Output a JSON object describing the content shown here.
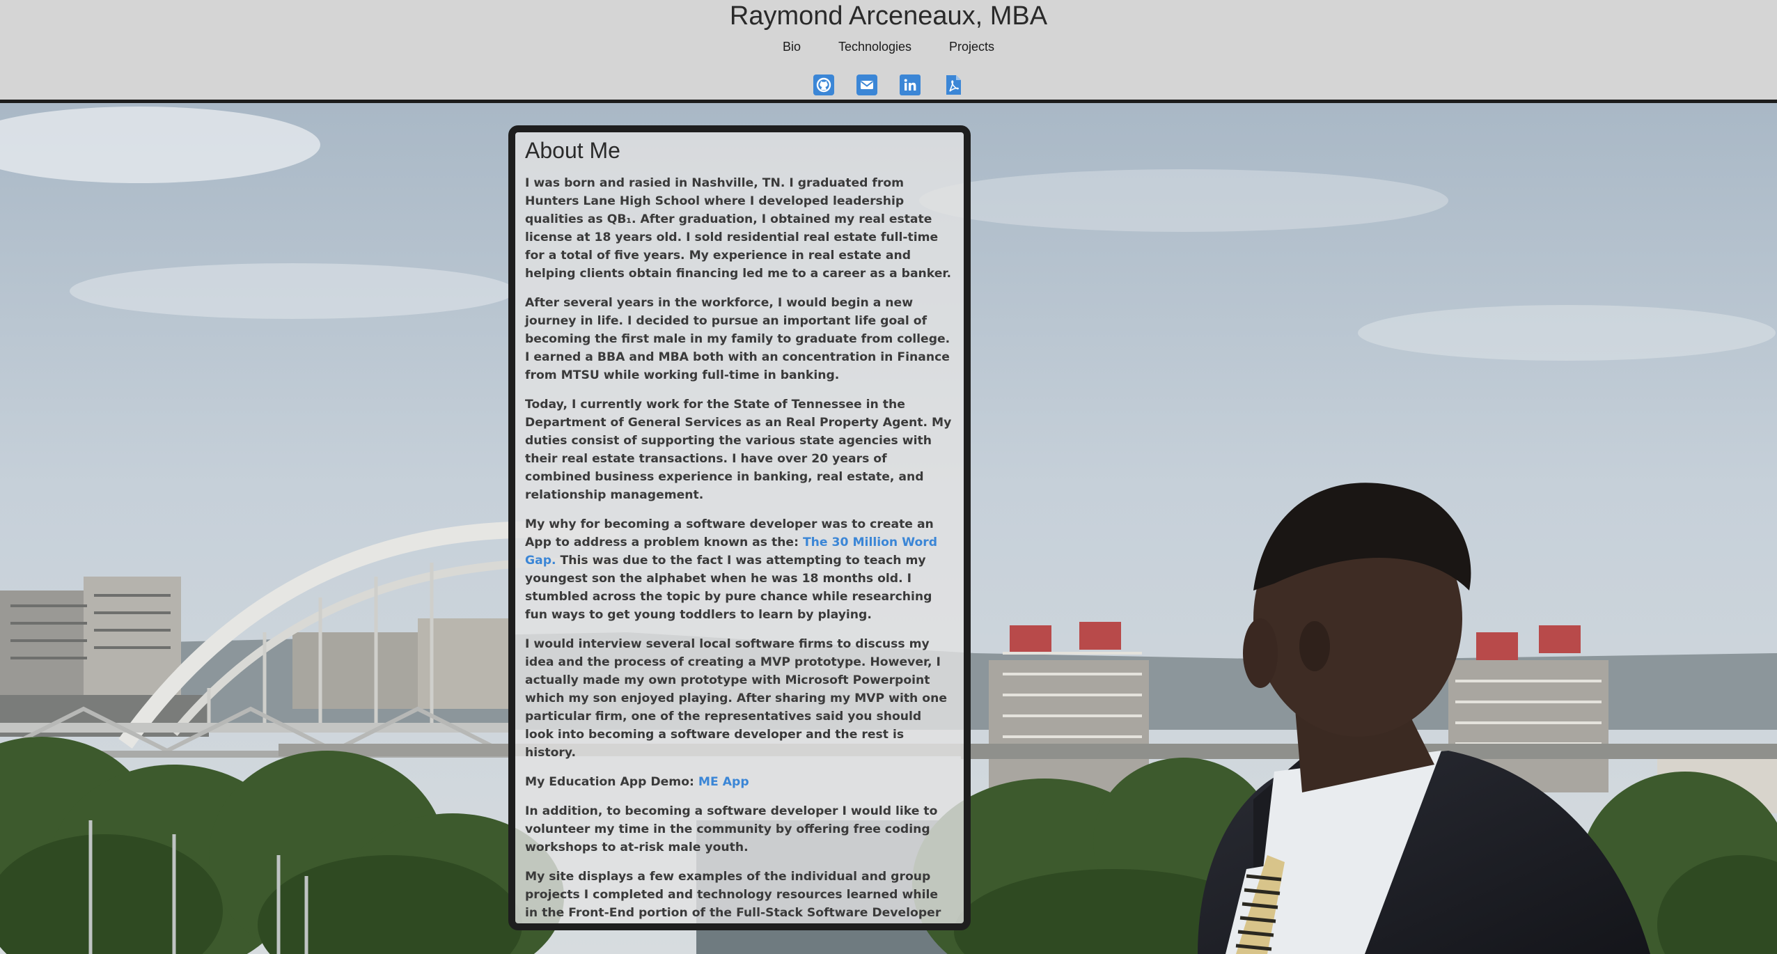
{
  "header": {
    "title": "Raymond Arceneaux, MBA",
    "nav": [
      {
        "label": "Bio"
      },
      {
        "label": "Technologies"
      },
      {
        "label": "Projects"
      }
    ],
    "social": [
      {
        "icon": "github-icon",
        "color": "#3b86d6"
      },
      {
        "icon": "email-icon",
        "color": "#3b86d6"
      },
      {
        "icon": "linkedin-icon",
        "color": "#3b86d6"
      },
      {
        "icon": "pdf-resume-icon",
        "color": "#3b86d6"
      }
    ]
  },
  "about": {
    "title": "About Me",
    "p1": "I was born and rasied in Nashville, TN. I graduated from Hunters Lane High School where I developed leadership qualities as QB₁. After graduation, I obtained my real estate license at 18 years old. I sold residential real estate full-time for a total of five years. My experience in real estate and helping clients obtain financing led me to a career as a banker.",
    "p2": "After several years in the workforce, I would begin a new journey in life. I decided to pursue an important life goal of becoming the first male in my family to graduate from college. I earned a BBA and MBA both with an concentration in Finance from MTSU while working full-time in banking.",
    "p3": "Today, I currently work for the State of Tennessee in the Department of General Services as an Real Property Agent. My duties consist of supporting the various state agencies with their real estate transactions. I have over 20 years of combined business experience in banking, real estate, and relationship management.",
    "p4_before": "My why for becoming a software developer was to create an App to address a problem known as the: ",
    "p4_link": "The 30 Million Word Gap.",
    "p4_after": " This was due to the fact I was attempting to teach my youngest son the alphabet when he was 18 months old. I stumbled across the topic by pure chance while researching fun ways to get young toddlers to learn by playing.",
    "p5": "I would interview several local software firms to discuss my idea and the process of creating a MVP prototype. However, I actually made my own prototype with Microsoft Powerpoint which my son enjoyed playing. After sharing my MVP with one particular firm, one of the representatives said you should look into becoming a software developer and the rest is history.",
    "p6_before": "My Education App Demo: ",
    "p6_link": "ME App",
    "p7": "In addition, to becoming a software developer I would like to volunteer my time in the community by offering free coding workshops to at-risk male youth.",
    "p8": "My site displays a few examples of the individual and group projects I completed and technology resources learned while in the Front-End portion of the Full-Stack Software Developer Bootcamp at NSS.",
    "link_color": "#3b86d6"
  }
}
